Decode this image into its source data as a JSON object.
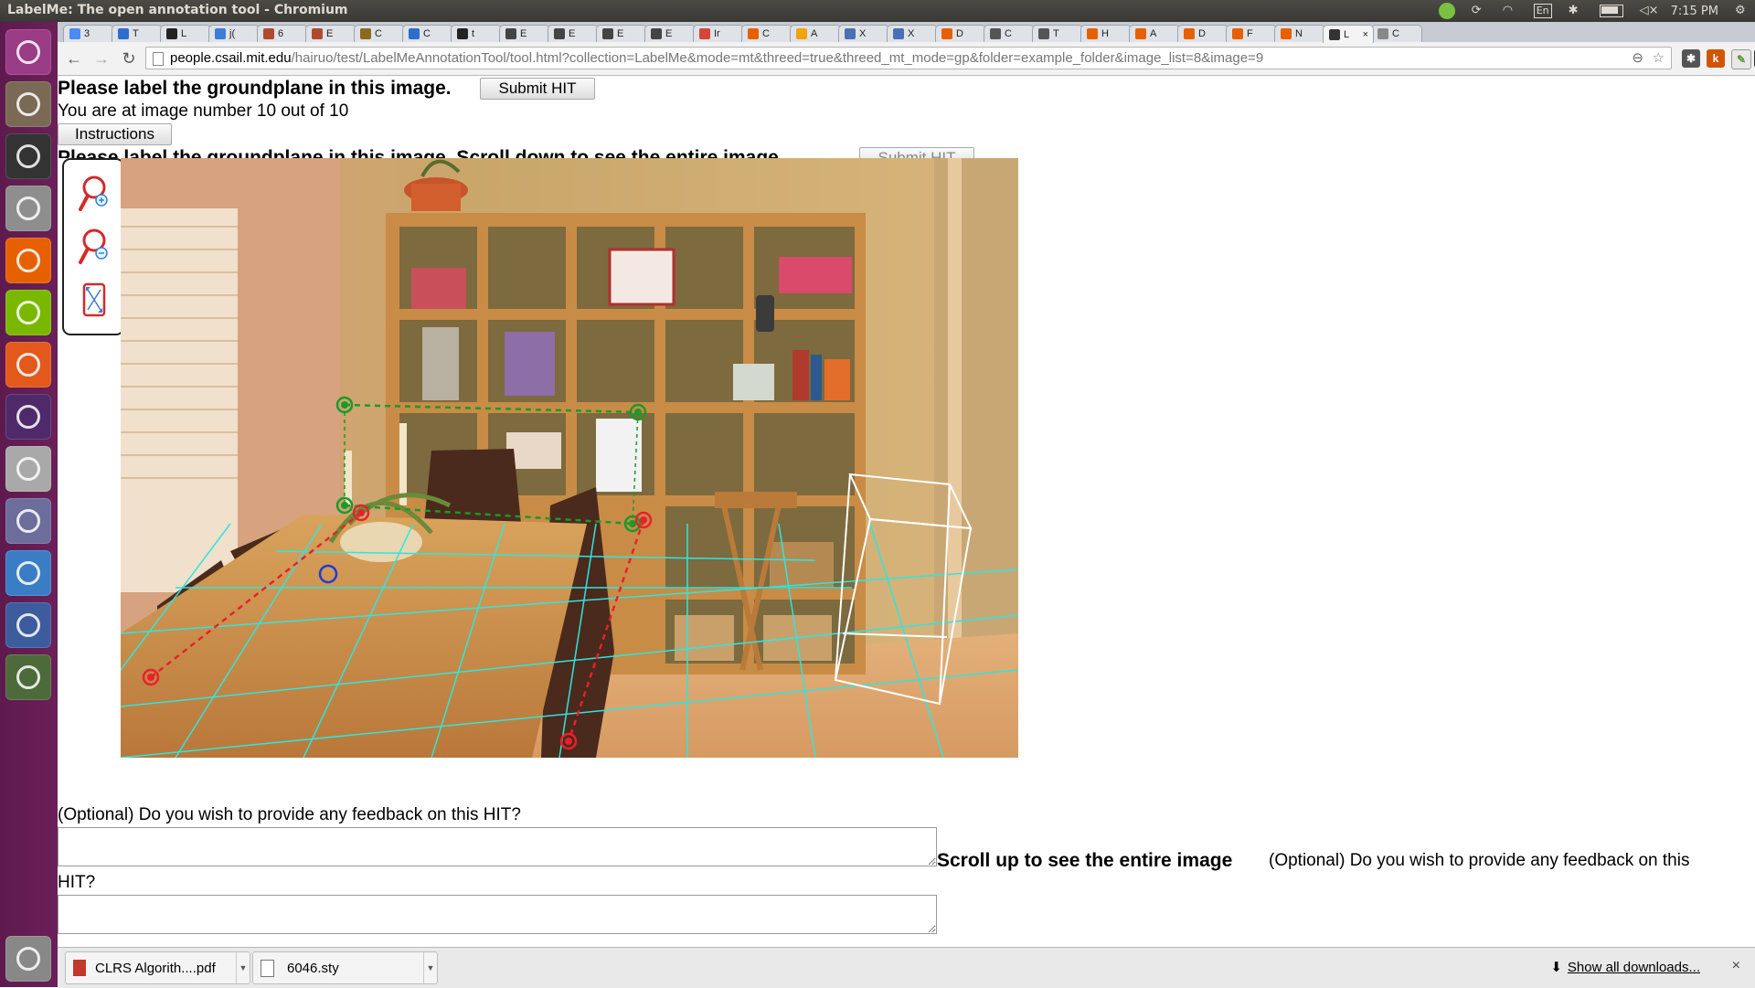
{
  "window": {
    "title": "LabelMe: The open annotation tool - Chromium",
    "clock": "7:15 PM",
    "keyboard_layout": "En"
  },
  "launcher": {
    "items": [
      {
        "name": "dash-home",
        "color": "#9a3b86"
      },
      {
        "name": "file-manager",
        "color": "#7a6a55"
      },
      {
        "name": "terminal",
        "color": "#333333"
      },
      {
        "name": "system-settings",
        "color": "#8e8e8e"
      },
      {
        "name": "firefox",
        "color": "#e66000"
      },
      {
        "name": "spotify",
        "color": "#7ab800"
      },
      {
        "name": "software-center",
        "color": "#e2591b"
      },
      {
        "name": "unity-app",
        "color": "#4f2a6b"
      },
      {
        "name": "disk-utility",
        "color": "#a9a9a9"
      },
      {
        "name": "inkscape",
        "color": "#6d6d9c"
      },
      {
        "name": "chromium",
        "color": "#3b7dc4"
      },
      {
        "name": "shotwell",
        "color": "#3d5c9e"
      },
      {
        "name": "software-updater",
        "color": "#4d6a3a"
      },
      {
        "name": "trash",
        "color": "#888888"
      }
    ]
  },
  "tabs": [
    {
      "label": "3",
      "fav": "#4b8bf4"
    },
    {
      "label": "T",
      "fav": "#2f6dcc"
    },
    {
      "label": "L",
      "fav": "#222222"
    },
    {
      "label": "j(",
      "fav": "#3b7dd8"
    },
    {
      "label": "6",
      "fav": "#b04a2d"
    },
    {
      "label": "E",
      "fav": "#b04a2d"
    },
    {
      "label": "C",
      "fav": "#8a6a1e"
    },
    {
      "label": "C",
      "fav": "#2f6dcc"
    },
    {
      "label": "t",
      "fav": "#222222"
    },
    {
      "label": "E",
      "fav": "#444444"
    },
    {
      "label": "E",
      "fav": "#444444"
    },
    {
      "label": "E",
      "fav": "#444444"
    },
    {
      "label": "E",
      "fav": "#444444"
    },
    {
      "label": "Ir",
      "fav": "#d44638"
    },
    {
      "label": "C",
      "fav": "#e66000"
    },
    {
      "label": "A",
      "fav": "#f0a30a"
    },
    {
      "label": "X",
      "fav": "#4b6fb3"
    },
    {
      "label": "X",
      "fav": "#4b6fb3"
    },
    {
      "label": "D",
      "fav": "#e66000"
    },
    {
      "label": "C",
      "fav": "#555555"
    },
    {
      "label": "T",
      "fav": "#555555"
    },
    {
      "label": "H",
      "fav": "#e66000"
    },
    {
      "label": "A",
      "fav": "#e66000"
    },
    {
      "label": "D",
      "fav": "#e66000"
    },
    {
      "label": "F",
      "fav": "#e66000"
    },
    {
      "label": "N",
      "fav": "#e66000"
    },
    {
      "label": "L",
      "fav": "#333333",
      "active": true
    },
    {
      "label": "C",
      "fav": "#888888"
    }
  ],
  "address_bar": {
    "host": "people.csail.mit.edu",
    "path": "/hairuo/test/LabelMeAnnotationTool/tool.html?collection=LabelMe&mode=mt&threed=true&threed_mt_mode=gp&folder=example_folder&image_list=8&image=9"
  },
  "extensions": [
    {
      "name": "extension-1-icon",
      "letter": "k",
      "color": "#d35400"
    },
    {
      "name": "extension-2-icon",
      "letter": "",
      "color": "#5a9b2f"
    },
    {
      "name": "extension-3-icon",
      "letter": "",
      "color": "#333333"
    }
  ],
  "page": {
    "heading": "Please label the groundplane in this image.",
    "submit_label": "Submit HIT",
    "image_counter": "You are at image number 10 out of 10",
    "instructions_label": "Instructions",
    "heading_overlap": "Please label the groundplane in this image. Scroll down to see the entire image.",
    "submit_overlap_label": "Submit HIT",
    "feedback_prompt": "(Optional) Do you wish to provide any feedback on this HIT?",
    "scroll_up_note": "Scroll up to see the entire image",
    "feedback_prompt_2_a": "(Optional) Do you wish to provide any feedback on this",
    "feedback_prompt_2_b": "HIT?"
  },
  "tools": [
    {
      "name": "zoom-in-icon"
    },
    {
      "name": "zoom-out-icon"
    },
    {
      "name": "fit-image-icon"
    }
  ],
  "annotation_colors": {
    "ground_grid": "#2ee6e0",
    "back_line": "#1a9a2a",
    "front_line": "#e8212b",
    "box": "#ffffff",
    "origin": "#1f3bd6"
  },
  "downloads": [
    {
      "name": "CLRS Algorith....pdf",
      "icon": "pdf"
    },
    {
      "name": "6046.sty",
      "icon": "file"
    }
  ],
  "downloads_link": "Show all downloads..."
}
